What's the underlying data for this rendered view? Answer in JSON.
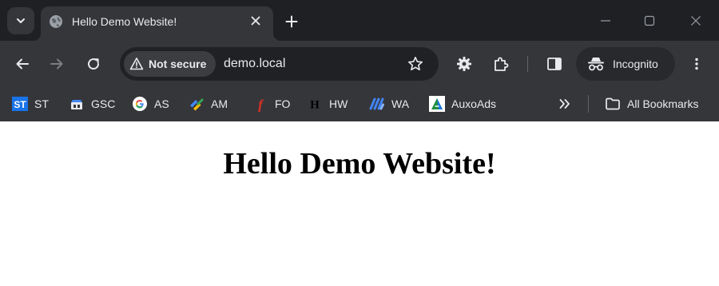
{
  "colors": {
    "titlebar_bg": "#1f2023",
    "toolbar_bg": "#35363a",
    "omnibox_bg": "#202124",
    "text": "#e8eaed",
    "page_bg": "#ffffff"
  },
  "tab": {
    "title": "Hello Demo Website!",
    "favicon": "globe-icon"
  },
  "toolbar": {
    "security_label": "Not secure",
    "url": "demo.local",
    "incognito_label": "Incognito"
  },
  "bookmarks": {
    "items": [
      {
        "label": "ST",
        "icon": "st-icon"
      },
      {
        "label": "GSC",
        "icon": "gsc-icon"
      },
      {
        "label": "AS",
        "icon": "google-icon"
      },
      {
        "label": "AM",
        "icon": "am-icon"
      },
      {
        "label": "FO",
        "icon": "fo-icon"
      },
      {
        "label": "HW",
        "icon": "hw-icon"
      },
      {
        "label": "WA",
        "icon": "wa-icon"
      },
      {
        "label": "AuxoAds",
        "icon": "auxoads-icon"
      }
    ],
    "all_label": "All Bookmarks"
  },
  "page": {
    "heading": "Hello Demo Website!"
  }
}
